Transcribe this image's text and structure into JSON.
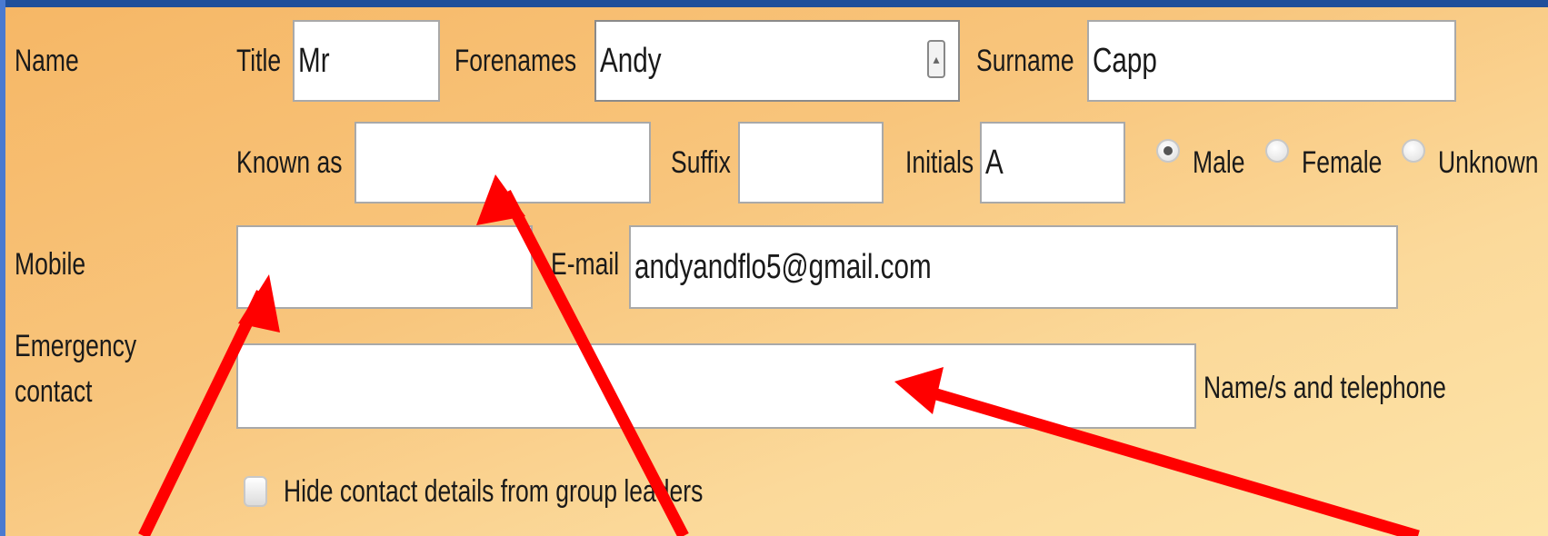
{
  "name_row": {
    "section_label": "Name",
    "title_label": "Title",
    "title_value": "Mr",
    "forenames_label": "Forenames",
    "forenames_value": "Andy",
    "surname_label": "Surname",
    "surname_value": "Capp"
  },
  "name_row2": {
    "known_as_label": "Known as",
    "known_as_value": "",
    "suffix_label": "Suffix",
    "suffix_value": "",
    "initials_label": "Initials",
    "initials_value": "A",
    "gender_options": [
      "Male",
      "Female",
      "Unknown"
    ],
    "gender_selected": "Male"
  },
  "contact": {
    "mobile_label": "Mobile",
    "mobile_value": "",
    "email_label": "E-mail",
    "email_value": "andyandflo5@gmail.com",
    "emergency_label_line1": "Emergency",
    "emergency_label_line2": "contact",
    "emergency_value": "",
    "emergency_hint": "Name/s and telephone",
    "hide_contact_label": "Hide contact details from group leaders",
    "hide_contact_checked": false
  },
  "annotation": {
    "arrow_color": "#ff0000"
  }
}
